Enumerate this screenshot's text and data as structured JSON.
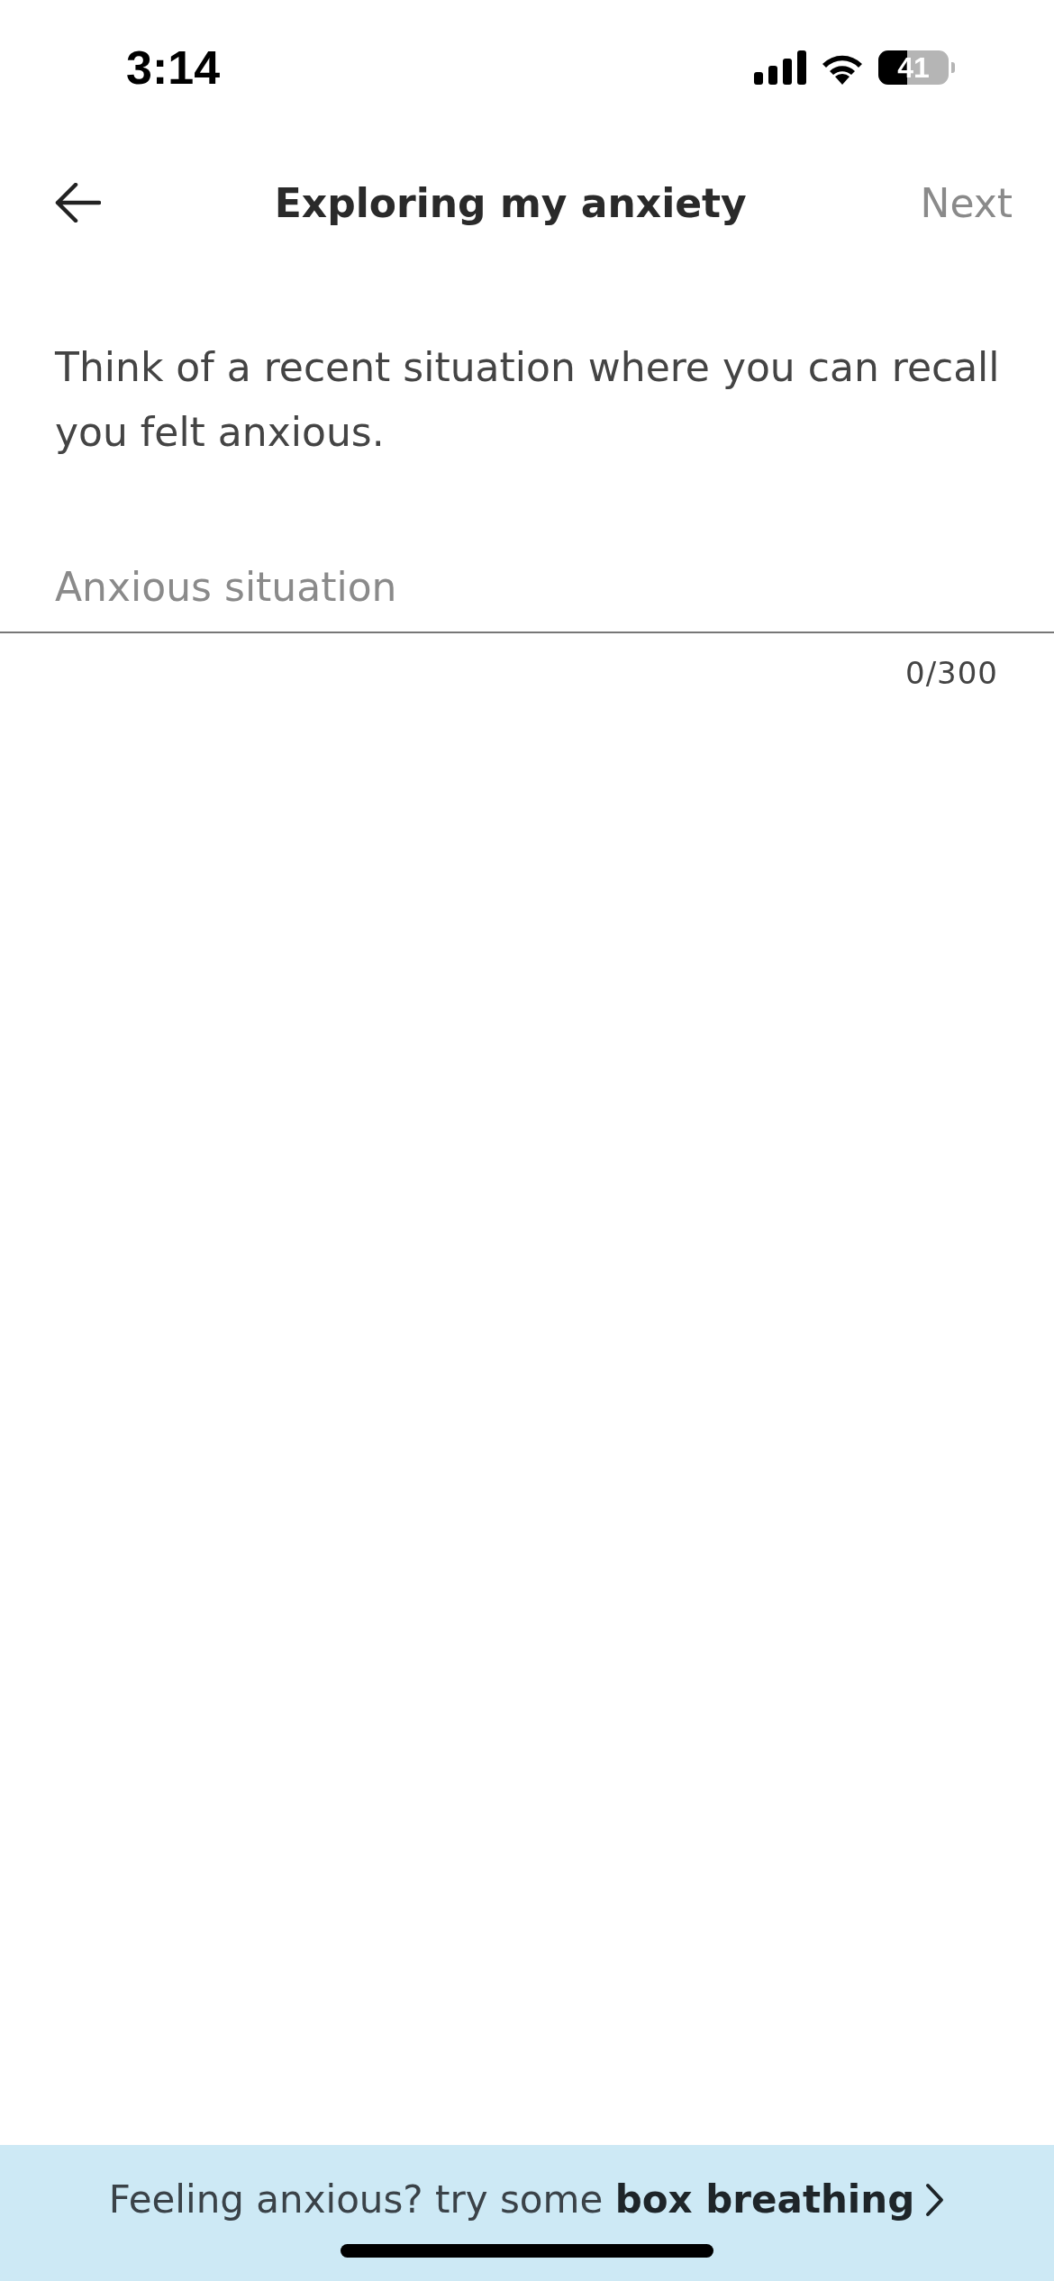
{
  "status_bar": {
    "time": "3:14",
    "battery": "41"
  },
  "header": {
    "title": "Exploring my anxiety",
    "next": {
      "label": "Next",
      "disabled": true
    }
  },
  "prompt": "Think of a recent situation where you can recall you felt anxious.",
  "field": {
    "placeholder": "Anxious situation",
    "counter": "0/300"
  },
  "banner": {
    "text": "Feeling anxious? try some **box breathing**"
  }
}
